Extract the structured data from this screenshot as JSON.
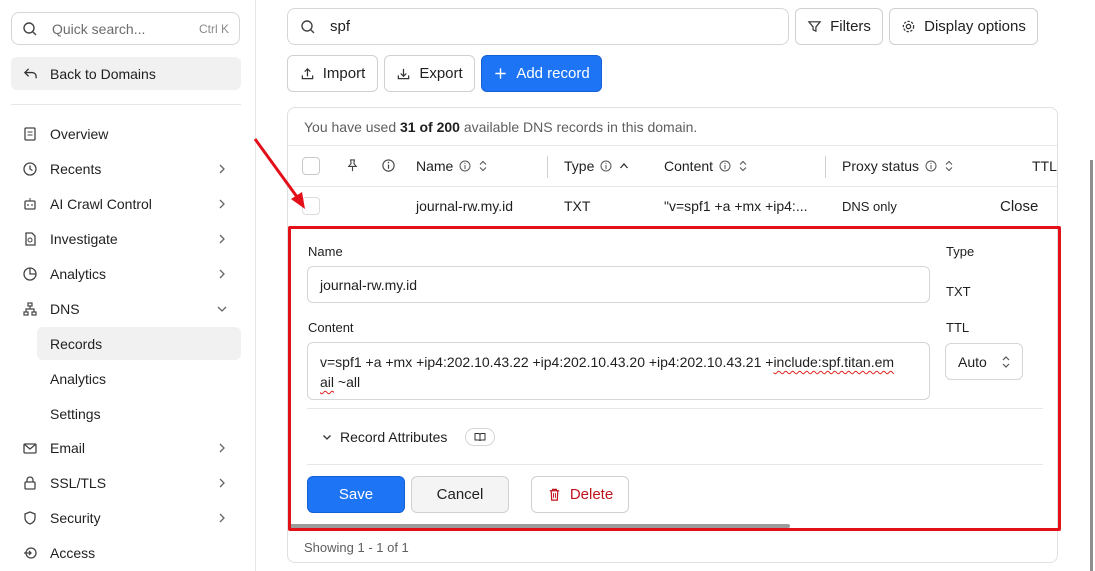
{
  "sidebar": {
    "search_placeholder": "Quick search...",
    "search_shortcut": "Ctrl K",
    "back_label": "Back to Domains",
    "items": [
      {
        "label": "Overview"
      },
      {
        "label": "Recents"
      },
      {
        "label": "AI Crawl Control"
      },
      {
        "label": "Investigate"
      },
      {
        "label": "Analytics"
      },
      {
        "label": "DNS"
      },
      {
        "label": "Email"
      },
      {
        "label": "SSL/TLS"
      },
      {
        "label": "Security"
      },
      {
        "label": "Access"
      }
    ],
    "dns_sub": [
      {
        "label": "Records"
      },
      {
        "label": "Analytics"
      },
      {
        "label": "Settings"
      }
    ]
  },
  "toolbar": {
    "search_value": "spf",
    "filters_label": "Filters",
    "display_label": "Display options",
    "import_label": "Import",
    "export_label": "Export",
    "add_label": "Add record"
  },
  "usage": {
    "prefix": "You have used",
    "count": "31 of 200",
    "suffix": "available DNS records in this domain."
  },
  "table": {
    "headers": {
      "name": "Name",
      "type": "Type",
      "content": "Content",
      "proxy": "Proxy status",
      "ttl": "TTL"
    },
    "row": {
      "name": "journal-rw.my.id",
      "type": "TXT",
      "content": "\"v=spf1 +a +mx +ip4:...",
      "proxy": "DNS only",
      "action": "Close"
    }
  },
  "editor": {
    "name_label": "Name",
    "name_value": "journal-rw.my.id",
    "type_label": "Type",
    "type_value": "TXT",
    "content_label": "Content",
    "content_line1_a": "v=spf1 +a +mx +ip4:202.10.43.22 +ip4:202.10.43.20 +ip4:202.10.43.21 +",
    "content_line1_b": "include:spf.titan.em",
    "content_line2_a": "ail",
    "content_line2_b": " ~all",
    "ttl_label": "TTL",
    "ttl_value": "Auto",
    "attributes_label": "Record Attributes",
    "save_label": "Save",
    "cancel_label": "Cancel",
    "delete_label": "Delete"
  },
  "footer": {
    "showing": "Showing 1 - 1 of 1"
  },
  "colors": {
    "primary": "#1d74f5",
    "highlight": "#e3101a",
    "delete": "#c0141c"
  }
}
